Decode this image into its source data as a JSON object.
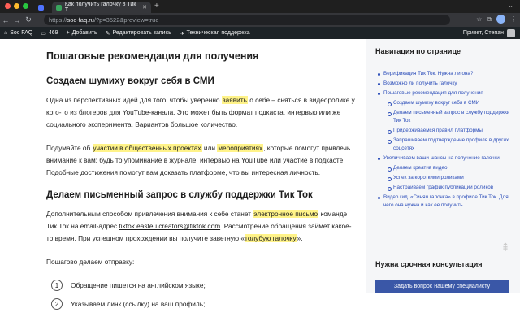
{
  "browser": {
    "tab_active_title": "Как получить галочку в Тик Т",
    "tab_new": "+",
    "url_scheme": "https://",
    "url_host": "soc-faq.ru",
    "url_path": "/?p=3522&preview=true"
  },
  "adminbar": {
    "site": "Soc FAQ",
    "comments_count": "469",
    "add": "Добавить",
    "edit": "Редактировать запись",
    "support": "Техническая поддержка",
    "greeting": "Привет, Степан"
  },
  "article": {
    "title": "Пошаговые рекомендация для получения",
    "h2_1": "Создаем шумиху вокруг себя в СМИ",
    "p1_a": "Одна из перспективных идей для того, чтобы уверенно ",
    "p1_hl": "заявить",
    "p1_b": " о себе – сняться в видеоролике у кого-то из блогеров для YouTube-канала. Это может быть формат подкаста, интервью или же социального эксперимента. Вариантов большое количество.",
    "p2_a": "Подумайте об ",
    "p2_hl1": "участии в общественных проектах",
    "p2_b": " или ",
    "p2_hl2": "мероприятиях",
    "p2_c": ", которые помогут привлечь внимание к вам: будь то упоминание в журнале, интервью на YouTube или участие в подкасте. Подобные достижения помогут вам доказать платформе, что вы интересная личность.",
    "h2_2": "Делаем письменный запрос в службу поддержки Тик Ток",
    "p3_a": "Дополнительным способом привлечения внимания к себе станет ",
    "p3_hl": "электронное письмо",
    "p3_b": " команде Тик Ток на email-адрес ",
    "p3_link": "tiktok.easteu.creators@tiktok.com",
    "p3_c": ". Рассмотрение обращения займет какое-то время. При успешном прохождении вы получите заветную «",
    "p3_hl2": "голубую галочку",
    "p3_d": "».",
    "p4": "Пошагово делаем отправку:",
    "steps": [
      {
        "n": "1",
        "text": "Обращение пишется на английском языке;"
      },
      {
        "n": "2",
        "text": "Указываем линк (ссылку) на ваш профиль;"
      }
    ]
  },
  "sidebar": {
    "title": "Навигация по странице",
    "toc": [
      {
        "text": "Верификация Тик Ток. Нужна ли она?",
        "sub": false
      },
      {
        "text": "Возможно ли получить галочку",
        "sub": false
      },
      {
        "text": "Пошаговые рекомендация для получения",
        "sub": false
      },
      {
        "text": "Создаем шумиху вокруг себя в СМИ",
        "sub": true
      },
      {
        "text": "Делаем письменный запрос в службу поддержки Тик Ток",
        "sub": true
      },
      {
        "text": "Придерживаемся правил платформы",
        "sub": true
      },
      {
        "text": "Запрашиваем подтверждение профиля в других соцсетях",
        "sub": true
      },
      {
        "text": "Увеличиваем ваши шансы на получение галочки",
        "sub": false
      },
      {
        "text": "Делаем креатив видео",
        "sub": true
      },
      {
        "text": "Успех за короткими роликами",
        "sub": true
      },
      {
        "text": "Настраиваем график публикации роликов",
        "sub": true
      },
      {
        "text": "Видео гид. «Синяя галочка» в профиле Тик Ток. Для чего она нужна и как ее получить.",
        "sub": false
      }
    ],
    "consult_title": "Нужна срочная консультация",
    "consult_btn": "Задать вопрос нашему специалисту"
  }
}
